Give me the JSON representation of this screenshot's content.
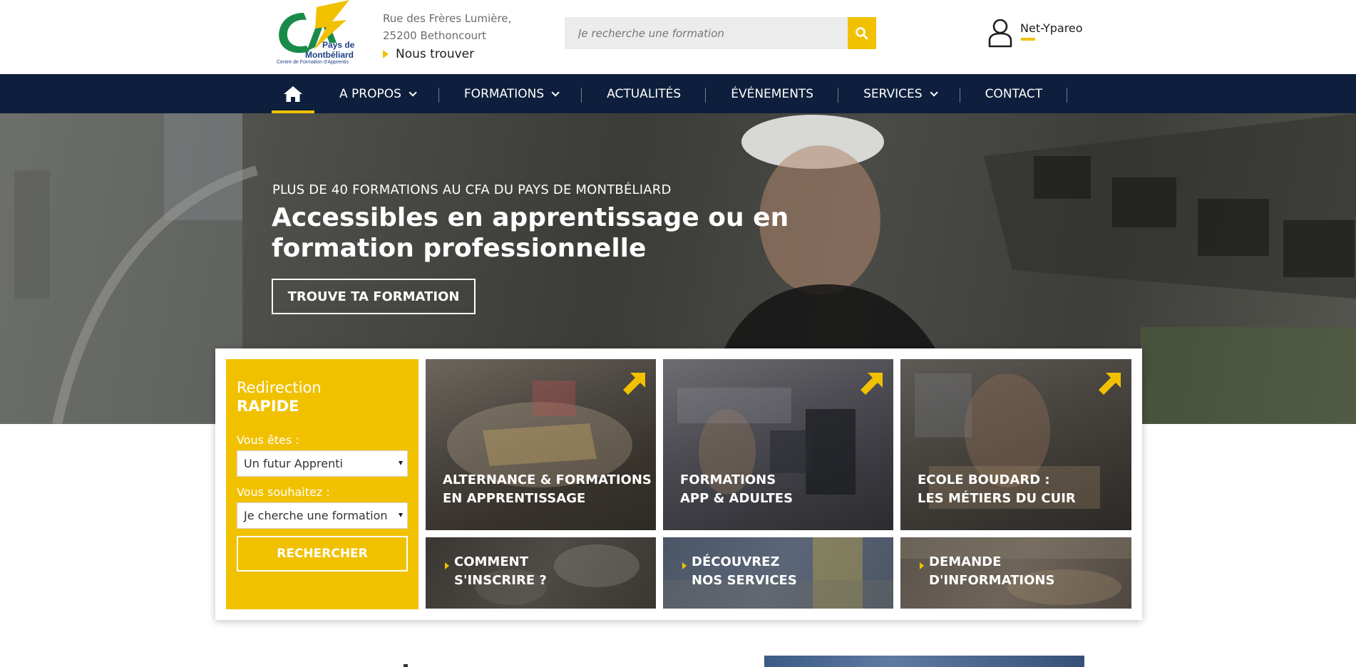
{
  "brand": {
    "logo_text_1": "Pays de",
    "logo_text_2": "Montbéliard",
    "logo_tagline": "Centre de Formation d'Apprentis",
    "colors": {
      "accent": "#f1c100",
      "navy": "#0d1f3c",
      "logo_green": "#1a8a4a",
      "logo_blue": "#1d3f87"
    }
  },
  "header": {
    "address_line1": "Rue des Frères Lumière,",
    "address_line2": "25200 Bethoncourt",
    "find_us_label": "Nous trouver",
    "search_placeholder": "Je recherche une formation",
    "search_icon": "magnifier-icon",
    "account_label": "Net-Ypareo",
    "account_icon": "user-icon"
  },
  "nav": {
    "home_icon": "home-icon",
    "items": [
      {
        "label": "A PROPOS",
        "dropdown": true
      },
      {
        "label": "FORMATIONS",
        "dropdown": true
      },
      {
        "label": "ACTUALITÉS",
        "dropdown": false
      },
      {
        "label": "ÉVÉNEMENTS",
        "dropdown": false
      },
      {
        "label": "SERVICES",
        "dropdown": true
      },
      {
        "label": "CONTACT",
        "dropdown": false
      }
    ]
  },
  "hero": {
    "kicker": "PLUS DE 40 FORMATIONS AU CFA DU PAYS DE MONTBÉLIARD",
    "title": "Accessibles en apprentissage ou en formation professionnelle",
    "cta": "TROUVE TA FORMATION"
  },
  "quick_redirect": {
    "title_line1": "Redirection",
    "title_line2": "RAPIDE",
    "field1_label": "Vous êtes :",
    "field1_value": "Un futur Apprenti",
    "field2_label": "Vous souhaitez :",
    "field2_value": "Je cherche une formation",
    "submit": "RECHERCHER"
  },
  "tiles": [
    {
      "line1": "ALTERNANCE & FORMATIONS",
      "line2": "EN APPRENTISSAGE",
      "icon": "arrow-up-right-icon"
    },
    {
      "line1": "FORMATIONS",
      "line2": "APP & ADULTES",
      "icon": "arrow-up-right-icon"
    },
    {
      "line1": "ECOLE BOUDARD :",
      "line2": "LES MÉTIERS DU CUIR",
      "icon": "arrow-up-right-icon"
    }
  ],
  "small_tiles": [
    {
      "line1": "COMMENT",
      "line2": "S'INSCRIRE ?"
    },
    {
      "line1": "DÉCOUVREZ",
      "line2": "NOS SERVICES"
    },
    {
      "line1": "DEMANDE",
      "line2": "D'INFORMATIONS"
    }
  ]
}
